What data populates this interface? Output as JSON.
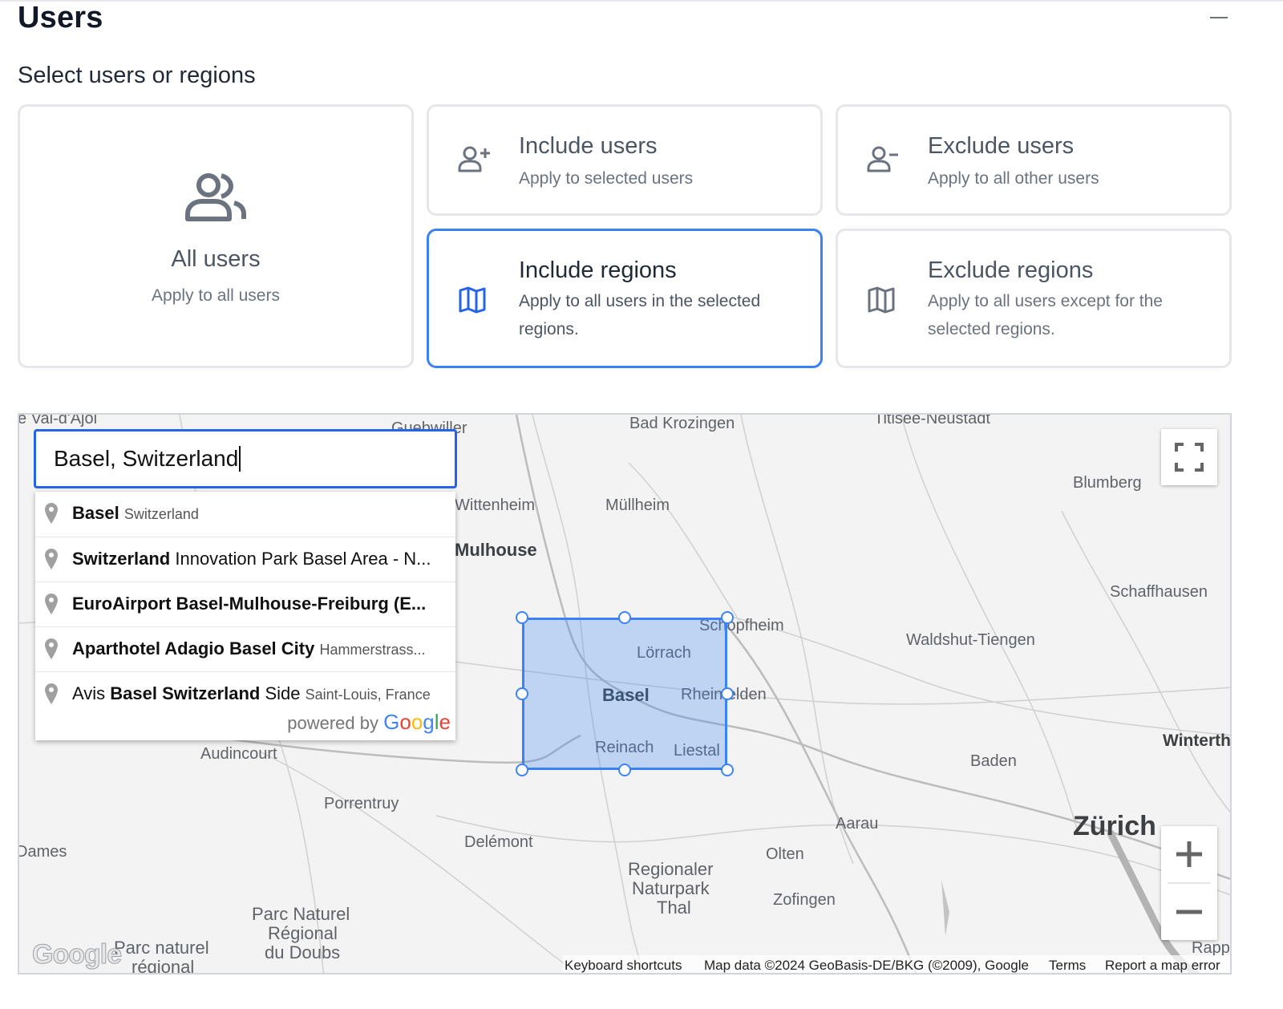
{
  "header": {
    "title": "Users",
    "subtitle": "Select users or regions"
  },
  "cards": {
    "all_users": {
      "title": "All users",
      "description": "Apply to all users",
      "icon": "users-group-icon"
    },
    "include_users": {
      "title": "Include users",
      "description": "Apply to selected users",
      "icon": "user-plus-icon"
    },
    "exclude_users": {
      "title": "Exclude users",
      "description": "Apply to all other users",
      "icon": "user-minus-icon"
    },
    "include_regions": {
      "title": "Include regions",
      "description": "Apply to all users in the selected regions.",
      "icon": "map-icon",
      "selected": true
    },
    "exclude_regions": {
      "title": "Exclude regions",
      "description": "Apply to all users except for the selected regions.",
      "icon": "map-icon"
    }
  },
  "map": {
    "search_value": "Basel, Switzerland",
    "suggestions": [
      {
        "bold": "Basel",
        "rest": "",
        "secondary": "Switzerland"
      },
      {
        "bold": "Switzerland",
        "rest": " Innovation Park Basel Area - N...",
        "secondary": ""
      },
      {
        "bold": "EuroAirport Basel-Mulhouse-Freiburg (E...",
        "rest": "",
        "secondary": ""
      },
      {
        "bold": "Aparthotel Adagio Basel City",
        "rest": " ",
        "secondary": "Hammerstrass..."
      },
      {
        "pre": "Avis ",
        "bold": "Basel Switzerland",
        "rest": " Side ",
        "secondary": "Saint-Louis, France"
      }
    ],
    "powered_by": "powered by",
    "powered_brand": "Google",
    "places": [
      {
        "name": "e Val-d'Ajol"
      },
      {
        "name": "Guebwiller"
      },
      {
        "name": "Bad Krozingen"
      },
      {
        "name": "Titisee-Neustadt"
      },
      {
        "name": "Blumberg"
      },
      {
        "name": "Wittenheim"
      },
      {
        "name": "Müllheim"
      },
      {
        "name": "Mulhouse"
      },
      {
        "name": "Schaffhausen"
      },
      {
        "name": "Schopfheim"
      },
      {
        "name": "Waldshut-Tiengen"
      },
      {
        "name": "Lörrach"
      },
      {
        "name": "Basel"
      },
      {
        "name": "Rheinfelden"
      },
      {
        "name": "Reinach"
      },
      {
        "name": "Liestal"
      },
      {
        "name": "Winterth"
      },
      {
        "name": "Baden"
      },
      {
        "name": "Audincourt"
      },
      {
        "name": "Porrentruy"
      },
      {
        "name": "Aarau"
      },
      {
        "name": "Zürich"
      },
      {
        "name": "Delémont"
      },
      {
        "name": "Olten"
      },
      {
        "name": "Dames"
      },
      {
        "name": "Regionaler"
      },
      {
        "name": "Naturpark"
      },
      {
        "name": "Thal"
      },
      {
        "name": "Zofingen"
      },
      {
        "name": "Parc Naturel"
      },
      {
        "name": "Régional"
      },
      {
        "name": "du Doubs"
      },
      {
        "name": "Parc naturel"
      },
      {
        "name": "régional"
      },
      {
        "name": "Rapp"
      }
    ],
    "footer": {
      "keyboard": "Keyboard shortcuts",
      "map_data": "Map data ©2024 GeoBasis-DE/BKG (©2009), Google",
      "terms": "Terms",
      "report": "Report a map error"
    },
    "logo_text": "Google",
    "accent_color": "#3b82f6"
  }
}
